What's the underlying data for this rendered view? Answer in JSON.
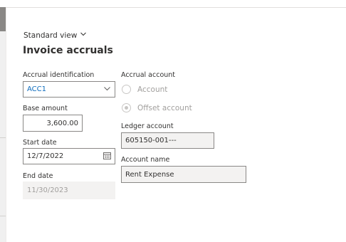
{
  "view": {
    "label": "Standard view"
  },
  "form": {
    "title": "Invoice accruals",
    "accrual_identification": {
      "label": "Accrual identification",
      "value": "ACC1"
    },
    "base_amount": {
      "label": "Base amount",
      "value": "3,600.00"
    },
    "start_date": {
      "label": "Start date",
      "value": "12/7/2022"
    },
    "end_date": {
      "label": "End date",
      "value": "11/30/2023"
    },
    "accrual_account": {
      "label": "Accrual account",
      "options": [
        {
          "label": "Account",
          "selected": false
        },
        {
          "label": "Offset account",
          "selected": true
        }
      ]
    },
    "ledger_account": {
      "label": "Ledger account",
      "value": "605150-001---"
    },
    "account_name": {
      "label": "Account name",
      "value": "Rent Expense"
    }
  },
  "icons": {
    "view_chevron": "chevron-down-icon",
    "dropdown_chevron": "chevron-down-icon",
    "calendar": "calendar-icon"
  },
  "colors": {
    "link_value": "#0f6cbd",
    "readonly_bg": "#f3f2f1",
    "border": "#8a8886"
  }
}
